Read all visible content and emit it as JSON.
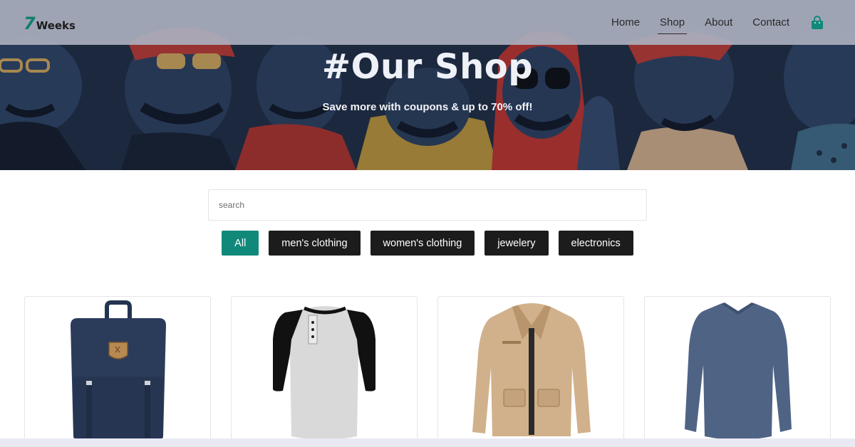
{
  "brand": {
    "mark": "7",
    "name": "Weeks"
  },
  "nav": {
    "items": [
      {
        "label": "Home",
        "active": false
      },
      {
        "label": "Shop",
        "active": true
      },
      {
        "label": "About",
        "active": false
      },
      {
        "label": "Contact",
        "active": false
      }
    ],
    "cart_icon": "shopping-bag-icon"
  },
  "hero": {
    "title": "#Our Shop",
    "subtitle": "Save more with coupons & up to 70% off!"
  },
  "search": {
    "placeholder": "search",
    "value": ""
  },
  "filters": [
    {
      "label": "All",
      "active": true
    },
    {
      "label": "men's clothing",
      "active": false
    },
    {
      "label": "women's clothing",
      "active": false
    },
    {
      "label": "jewelery",
      "active": false
    },
    {
      "label": "electronics",
      "active": false
    }
  ],
  "products": [
    {
      "image": "backpack-image"
    },
    {
      "image": "raglan-henley-shirt-image"
    },
    {
      "image": "cotton-jacket-image"
    },
    {
      "image": "long-sleeve-tshirt-image"
    }
  ],
  "colors": {
    "accent": "#11897a",
    "button_dark": "#1c1c1c",
    "navbar": "#aaafbe"
  }
}
